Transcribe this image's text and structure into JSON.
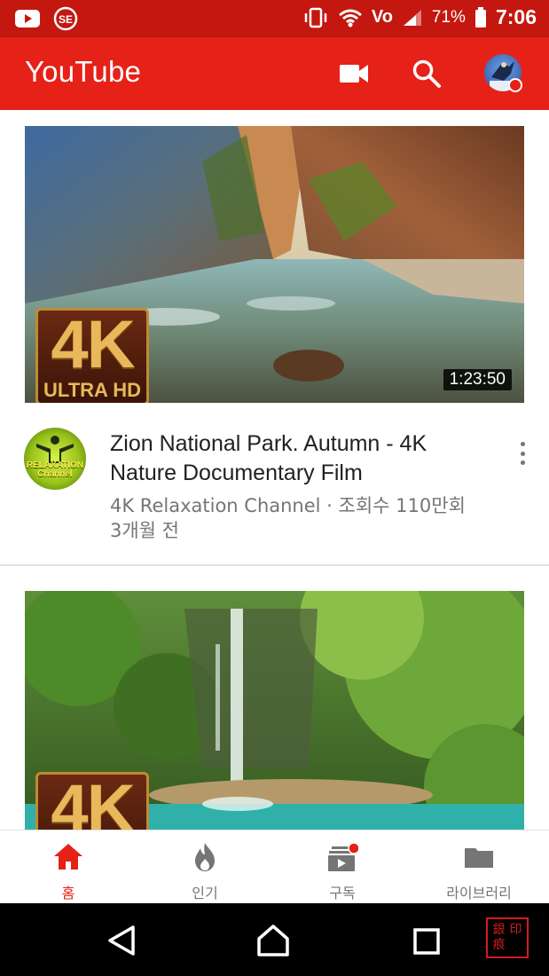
{
  "status_bar": {
    "battery_percent": "71%",
    "time": "7:06",
    "network_label": "Vo",
    "icons": [
      "youtube-notification-icon",
      "app-notification-icon",
      "vibrate-icon",
      "wifi-icon",
      "volte-icon",
      "cellular-signal-icon",
      "battery-icon"
    ]
  },
  "app_bar": {
    "title": "YouTube",
    "actions": [
      "camera-icon",
      "search-icon",
      "account-avatar"
    ]
  },
  "feed": {
    "videos": [
      {
        "title": "Zion National Park. Autumn - 4K Nature Documentary Film",
        "channel": "4K Relaxation Channel",
        "views": "조회수 110만회",
        "age": "3개월 전",
        "duration": "1:23:50",
        "badge_big": "4K",
        "badge_small": "ULTRA HD",
        "channel_avatar_text": "RELAXATION Channel"
      },
      {
        "badge_big": "4K"
      }
    ]
  },
  "bottom_nav": {
    "items": [
      {
        "label": "홈",
        "icon": "home-icon",
        "active": true
      },
      {
        "label": "인기",
        "icon": "trending-flame-icon",
        "active": false
      },
      {
        "label": "구독",
        "icon": "subscriptions-icon",
        "active": false
      },
      {
        "label": "라이브러리",
        "icon": "library-folder-icon",
        "active": false
      }
    ]
  },
  "system_nav": {
    "buttons": [
      "back-icon",
      "home-circle-icon",
      "recents-icon"
    ],
    "watermark": [
      "銀",
      "印",
      "痕",
      ""
    ]
  },
  "colors": {
    "status_bar": "#c4170f",
    "app_bar": "#e62117",
    "accent": "#e62117",
    "text_primary": "#212121",
    "text_secondary": "#757575"
  }
}
